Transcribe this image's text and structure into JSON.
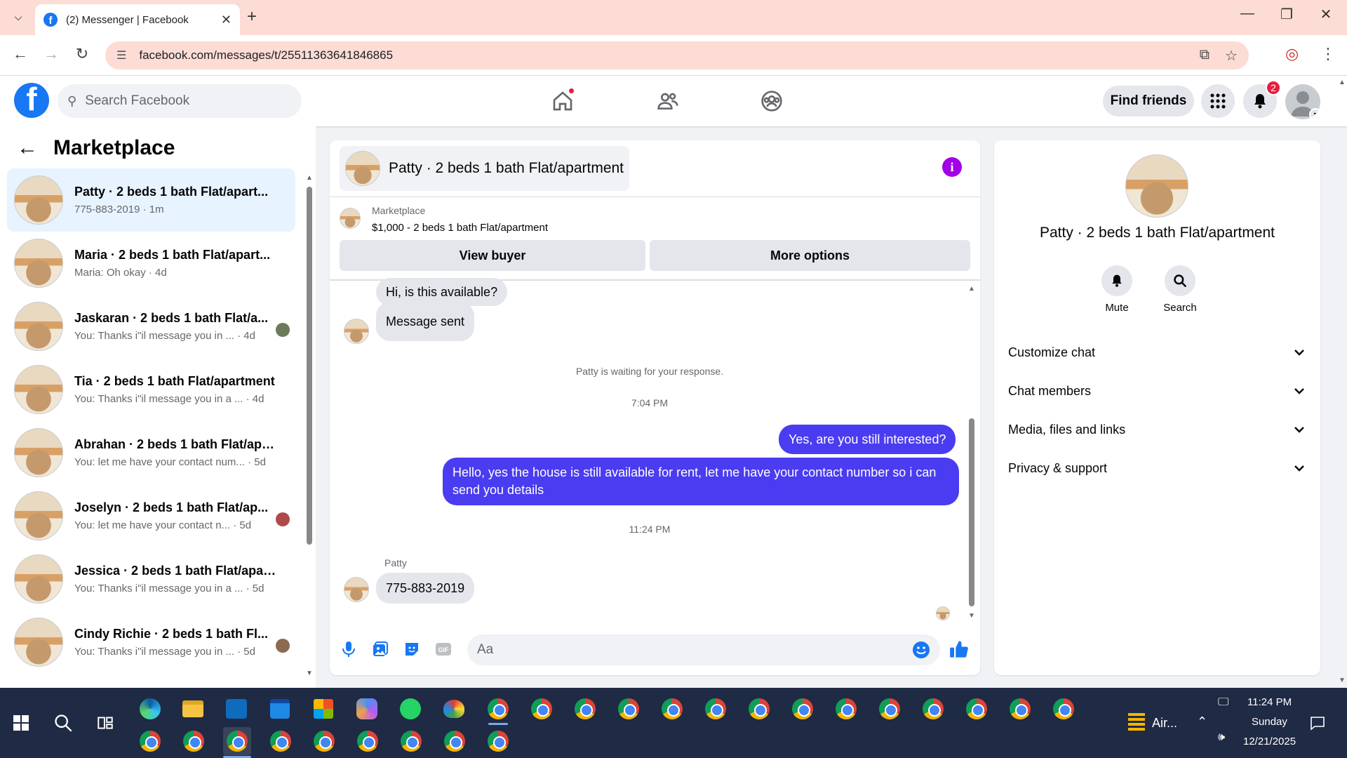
{
  "browser": {
    "tab_title": "(2) Messenger | Facebook",
    "url": "facebook.com/messages/t/25511363641846865"
  },
  "fb_header": {
    "search_placeholder": "Search Facebook",
    "find_friends_label": "Find friends",
    "notification_count": "2"
  },
  "sidebar": {
    "title": "Marketplace",
    "conversations": [
      {
        "name": "Patty · 2 beds 1 bath Flat/apart...",
        "preview": "775-883-2019 · 1m",
        "active": true
      },
      {
        "name": "Maria · 2 beds 1 bath Flat/apart...",
        "preview": "Maria: Oh okay · 4d"
      },
      {
        "name": "Jaskaran · 2 beds 1 bath Flat/a...",
        "preview": "You: Thanks i\"il message you in ... · 4d"
      },
      {
        "name": "Tia · 2 beds 1 bath Flat/apartment",
        "preview": "You: Thanks i\"il message you in a ... · 4d"
      },
      {
        "name": "Abrahan · 2 beds 1 bath Flat/apa...",
        "preview": "You: let me have your contact num... · 5d"
      },
      {
        "name": "Joselyn · 2 beds 1 bath Flat/ap...",
        "preview": "You: let me have your contact n... · 5d"
      },
      {
        "name": "Jessica · 2 beds 1 bath Flat/apart...",
        "preview": "You: Thanks i\"il message you in a ... · 5d"
      },
      {
        "name": "Cindy Richie · 2 beds 1 bath Fl...",
        "preview": "You: Thanks i\"il message you in ... · 5d"
      }
    ]
  },
  "chat": {
    "title": "Patty · 2 beds 1 bath Flat/apartment",
    "marketplace_label": "Marketplace",
    "listing": "$1,000 - 2 beds 1 bath Flat/apartment",
    "view_buyer_label": "View buyer",
    "more_options_label": "More options",
    "messages": {
      "in1": "Hi, is this available?",
      "in2": "Message sent",
      "waiting": "Patty is waiting for your response.",
      "time1": "7:04 PM",
      "out1": "Yes, are you still interested?",
      "out2": "Hello, yes the house is still available for rent, let me have your contact number so i can send you details",
      "time2": "11:24 PM",
      "sender": "Patty",
      "in3": "775-883-2019"
    },
    "composer_placeholder": "Aa"
  },
  "right_panel": {
    "name": "Patty · 2 beds 1 bath Flat/apartment",
    "mute_label": "Mute",
    "search_label": "Search",
    "sections": [
      "Customize chat",
      "Chat members",
      "Media, files and links",
      "Privacy & support"
    ]
  },
  "taskbar": {
    "air_label": "Air...",
    "time": "11:24 PM",
    "day": "Sunday",
    "date": "12/21/2025"
  },
  "colors": {
    "fb_blue": "#1877f2",
    "outgoing_bubble": "#4a3cf0",
    "info_purple": "#a200e6",
    "tab_bar": "#fcdcd4",
    "taskbar": "#1f2a44"
  }
}
